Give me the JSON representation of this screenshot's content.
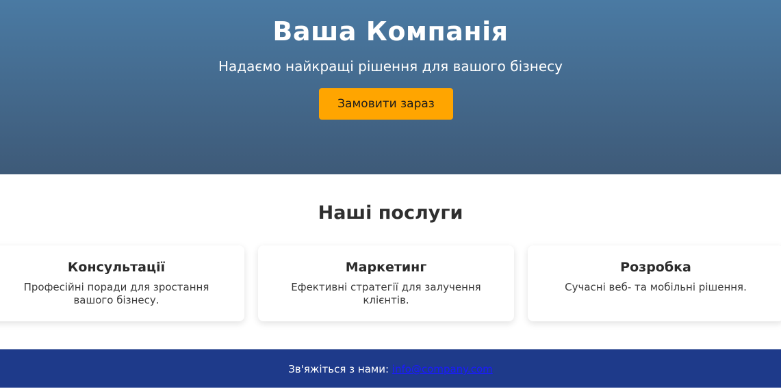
{
  "hero": {
    "title": "Ваша Компанія",
    "subtitle": "Надаємо найкращі рішення для вашого бізнесу",
    "cta_label": "Замовити зараз"
  },
  "services": {
    "title": "Наші послуги",
    "items": [
      {
        "title": "Консультації",
        "description": "Професійні поради для зростання вашого бізнесу."
      },
      {
        "title": "Маркетинг",
        "description": "Ефективні стратегії для залучення клієнтів."
      },
      {
        "title": "Розробка",
        "description": "Сучасні веб- та мобільні рішення."
      }
    ]
  },
  "footer": {
    "contact_label": "Зв'яжіться з нами:",
    "email": "info@company.com"
  },
  "colors": {
    "hero_top": "#4a7aa3",
    "hero_bottom": "#3e5a78",
    "accent": "#ffa500",
    "footer_bg": "#1e3a8a",
    "link": "#1a1aff"
  }
}
